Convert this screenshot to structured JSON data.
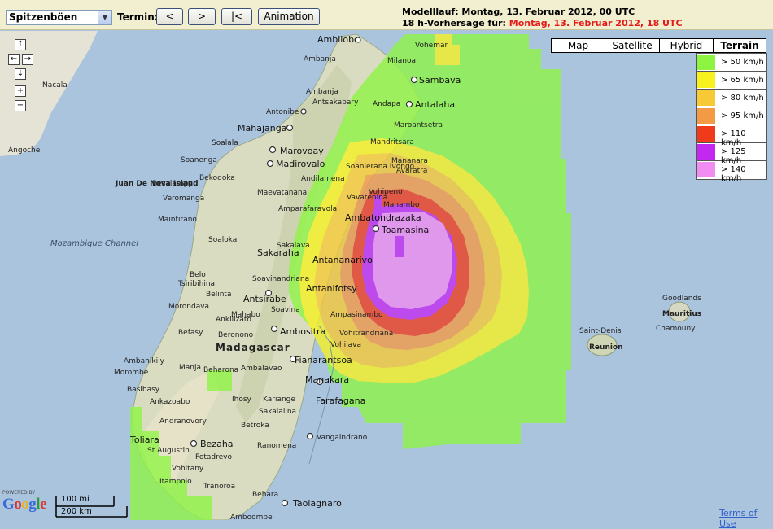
{
  "toolbar": {
    "product_select": "Spitzenböen",
    "termin_label": "Termin:",
    "prev_label": "<",
    "next_label": ">",
    "first_label": "|<",
    "animation_label": "Animation",
    "run_text": "Modelllauf: Montag, 13. Februar 2012, 00 UTC",
    "forecast_prefix": "18 h-Vorhersage für: ",
    "forecast_time": "Montag, 13. Februar 2012, 18 UTC"
  },
  "map_types": [
    "Map",
    "Satellite",
    "Hybrid",
    "Terrain"
  ],
  "legend": [
    {
      "color": "#8df542",
      "label": "> 50 km/h"
    },
    {
      "color": "#f7f21f",
      "label": "> 65 km/h"
    },
    {
      "color": "#f7c935",
      "label": "> 80 km/h"
    },
    {
      "color": "#f39a45",
      "label": "> 95 km/h"
    },
    {
      "color": "#f03a1c",
      "label": "> 110 km/h"
    },
    {
      "color": "#c328f0",
      "label": "> 125 km/h"
    },
    {
      "color": "#f08cf2",
      "label": "> 140 km/h"
    }
  ],
  "nav": {
    "up": "↑",
    "left": "←",
    "right": "→",
    "down": "↓",
    "zoom_in": "+",
    "zoom_out": "−"
  },
  "places": [
    {
      "name": "Ambilobe",
      "cls": "town"
    },
    {
      "name": "Vohemar",
      "cls": "small"
    },
    {
      "name": "Ambanja",
      "cls": "small"
    },
    {
      "name": "Milanoa",
      "cls": "small"
    },
    {
      "name": "Nacala",
      "cls": "small"
    },
    {
      "name": "Sambava",
      "cls": "town"
    },
    {
      "name": "Ambanja",
      "cls": "small"
    },
    {
      "name": "Antsakabary",
      "cls": "small"
    },
    {
      "name": "Antonibe",
      "cls": "small"
    },
    {
      "name": "Andapa",
      "cls": "small"
    },
    {
      "name": "Antalaha",
      "cls": "town"
    },
    {
      "name": "Mahajanga",
      "cls": "town"
    },
    {
      "name": "Maroantsetra",
      "cls": "small"
    },
    {
      "name": "Angoche",
      "cls": "small"
    },
    {
      "name": "Soalala",
      "cls": "small"
    },
    {
      "name": "Marovoay",
      "cls": "town"
    },
    {
      "name": "Mandritsara",
      "cls": "small"
    },
    {
      "name": "Soanenga",
      "cls": "small"
    },
    {
      "name": "Madirovalo",
      "cls": "town"
    },
    {
      "name": "Mananara",
      "cls": "small"
    },
    {
      "name": "Besalampy",
      "cls": "small"
    },
    {
      "name": "Bekodoka",
      "cls": "small"
    },
    {
      "name": "Soanierana Ivongo",
      "cls": "small"
    },
    {
      "name": "Avaratra",
      "cls": "small"
    },
    {
      "name": "Andilamena",
      "cls": "small"
    },
    {
      "name": "Juan De Nova Island",
      "cls": "bold"
    },
    {
      "name": "Maevatanana",
      "cls": "small"
    },
    {
      "name": "Vohipeno",
      "cls": "small"
    },
    {
      "name": "Veromanga",
      "cls": "small"
    },
    {
      "name": "Vavatenina",
      "cls": "small"
    },
    {
      "name": "Mahambo",
      "cls": "small"
    },
    {
      "name": "Amparafaravola",
      "cls": "small"
    },
    {
      "name": "Ambatondrazaka",
      "cls": "town"
    },
    {
      "name": "Maintirano",
      "cls": "small"
    },
    {
      "name": "Toamasina",
      "cls": "town"
    },
    {
      "name": "Mozambique Channel",
      "cls": "sea"
    },
    {
      "name": "Soaloka",
      "cls": "small"
    },
    {
      "name": "Sakalava",
      "cls": "small"
    },
    {
      "name": "Antananarivo",
      "cls": "town"
    },
    {
      "name": "Sakaraha",
      "cls": "small"
    },
    {
      "name": "Belo",
      "cls": "small"
    },
    {
      "name": "Antanifotsy",
      "cls": "town"
    },
    {
      "name": "Soavinandriana",
      "cls": "small"
    },
    {
      "name": "Tsiribihina",
      "cls": "small"
    },
    {
      "name": "Belinta",
      "cls": "small"
    },
    {
      "name": "Antsirabe",
      "cls": "town"
    },
    {
      "name": "Goodlands",
      "cls": "small"
    },
    {
      "name": "Mauritius",
      "cls": "bold"
    },
    {
      "name": "Morondava",
      "cls": "small"
    },
    {
      "name": "Mahabo",
      "cls": "small"
    },
    {
      "name": "Soavina",
      "cls": "small"
    },
    {
      "name": "Ampasinambo",
      "cls": "small"
    },
    {
      "name": "Chamouny",
      "cls": "small"
    },
    {
      "name": "Ankilizato",
      "cls": "small"
    },
    {
      "name": "Ambositra",
      "cls": "town"
    },
    {
      "name": "Befasy",
      "cls": "small"
    },
    {
      "name": "Beronono",
      "cls": "small"
    },
    {
      "name": "Vohitrandriana",
      "cls": "small"
    },
    {
      "name": "Saint-Denis",
      "cls": "small"
    },
    {
      "name": "Madagascar",
      "cls": "country"
    },
    {
      "name": "Vohilava",
      "cls": "small"
    },
    {
      "name": "Reunion",
      "cls": "bold"
    },
    {
      "name": "Ambahikily",
      "cls": "small"
    },
    {
      "name": "Fianarantsoa",
      "cls": "town"
    },
    {
      "name": "Morombe",
      "cls": "small"
    },
    {
      "name": "Manja",
      "cls": "small"
    },
    {
      "name": "Beharona",
      "cls": "small"
    },
    {
      "name": "Ambalavao",
      "cls": "small"
    },
    {
      "name": "Manakara",
      "cls": "town"
    },
    {
      "name": "Basibasy",
      "cls": "small"
    },
    {
      "name": "Ankazoabo",
      "cls": "small"
    },
    {
      "name": "Ihosy",
      "cls": "small"
    },
    {
      "name": "Kariange",
      "cls": "small"
    },
    {
      "name": "Sakalalina",
      "cls": "small"
    },
    {
      "name": "Farafagana",
      "cls": "town"
    },
    {
      "name": "Andranovory",
      "cls": "small"
    },
    {
      "name": "Betroka",
      "cls": "small"
    },
    {
      "name": "Vangaindrano",
      "cls": "small"
    },
    {
      "name": "Toliara",
      "cls": "town"
    },
    {
      "name": "Ranomena",
      "cls": "small"
    },
    {
      "name": "St Augustin",
      "cls": "small"
    },
    {
      "name": "Bezaha",
      "cls": "town"
    },
    {
      "name": "Fotadrevo",
      "cls": "small"
    },
    {
      "name": "Vohitany",
      "cls": "small"
    },
    {
      "name": "Tranoroa",
      "cls": "small"
    },
    {
      "name": "Itampolo",
      "cls": "small"
    },
    {
      "name": "Behara",
      "cls": "small"
    },
    {
      "name": "Taolagnaro",
      "cls": "town"
    },
    {
      "name": "Amboombe",
      "cls": "small"
    }
  ],
  "scale": {
    "mi": "100 mi",
    "km": "200 km"
  },
  "google": {
    "powered": "POWERED BY",
    "logo": "Google"
  },
  "terms": "Terms of Use"
}
